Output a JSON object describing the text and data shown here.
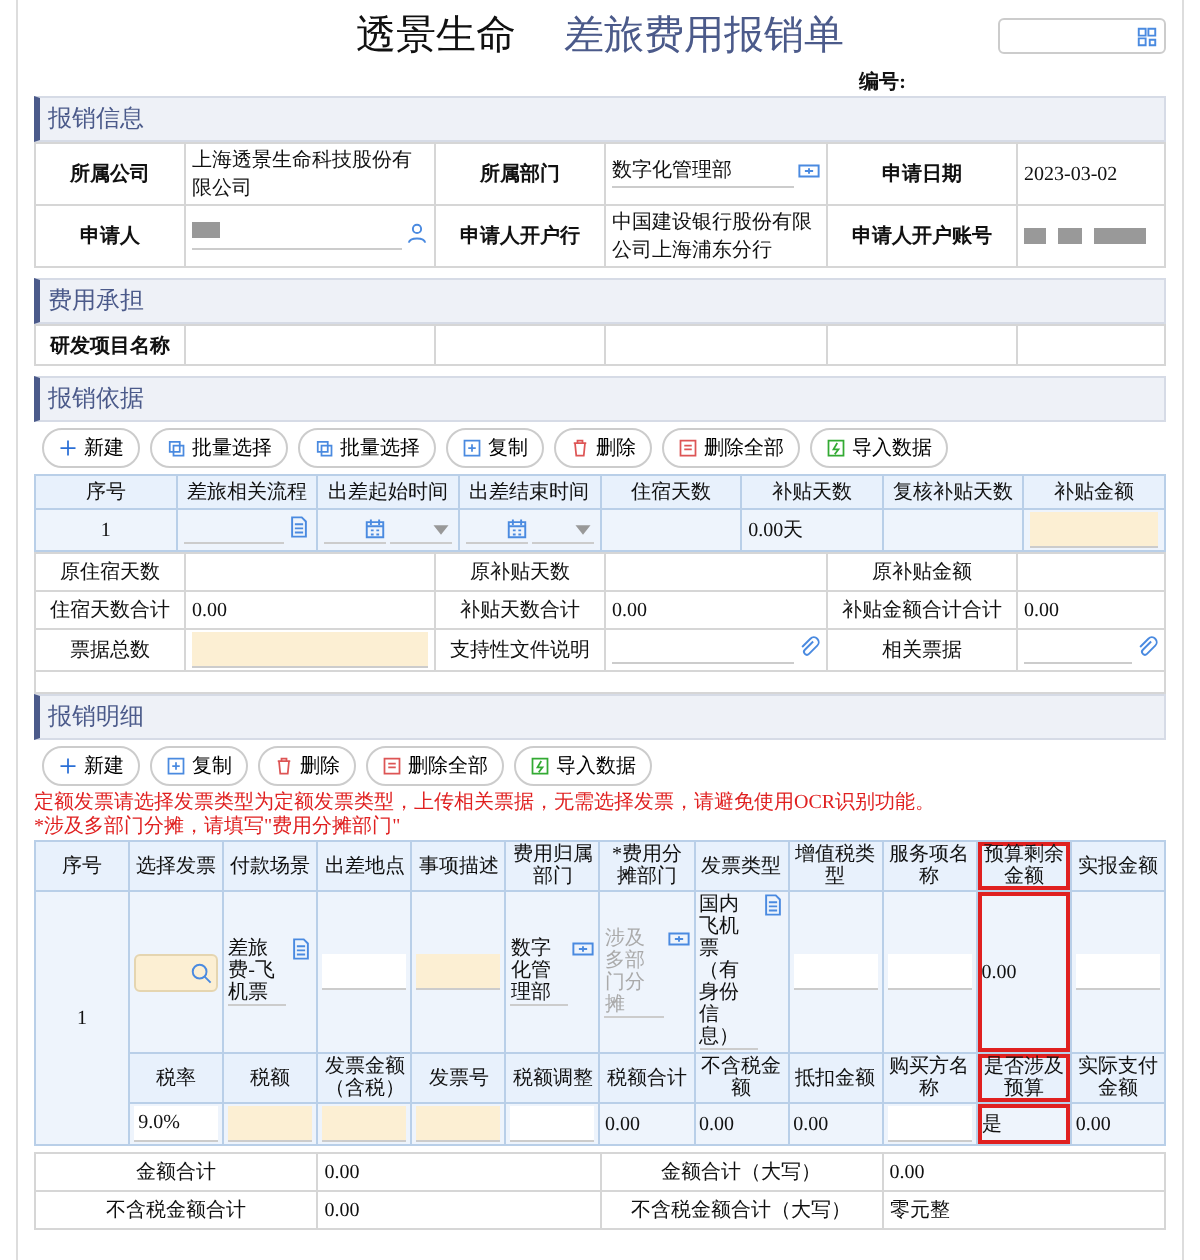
{
  "header": {
    "company": "透景生命",
    "title": "差旅费用报销单",
    "number_label": "编号:"
  },
  "info": {
    "title": "报销信息",
    "rows": [
      [
        {
          "label": "所属公司",
          "kind": "text",
          "value": "上海透景生命科技股份有限公司"
        },
        {
          "label": "所属部门",
          "kind": "picker",
          "value": "数字化管理部"
        },
        {
          "label": "申请日期",
          "kind": "text",
          "value": "2023-03-02"
        }
      ],
      [
        {
          "label": "申请人",
          "kind": "user"
        },
        {
          "label": "申请人开户行",
          "kind": "text",
          "value": "中国建设银行股份有限公司上海浦东分行"
        },
        {
          "label": "申请人开户账号",
          "kind": "redacted"
        }
      ]
    ]
  },
  "cost": {
    "title": "费用承担",
    "label": "研发项目名称"
  },
  "basis": {
    "title": "报销依据",
    "buttons": [
      {
        "label": "新建",
        "kind": "new"
      },
      {
        "label": "批量选择",
        "kind": "batch"
      },
      {
        "label": "批量选择",
        "kind": "batch"
      },
      {
        "label": "复制",
        "kind": "copy"
      },
      {
        "label": "删除",
        "kind": "delete"
      },
      {
        "label": "删除全部",
        "kind": "delete-all"
      },
      {
        "label": "导入数据",
        "kind": "import"
      }
    ],
    "columns": [
      "序号",
      "差旅相关流程",
      "出差起始时间",
      "出差结束时间",
      "住宿天数",
      "补贴天数",
      "复核补贴天数",
      "补贴金额"
    ],
    "row": [
      {
        "kind": "text",
        "text": "1"
      },
      {
        "kind": "lookup"
      },
      {
        "kind": "date"
      },
      {
        "kind": "date"
      },
      {
        "kind": "blank"
      },
      {
        "kind": "text",
        "text": "0.00天"
      },
      {
        "kind": "blank"
      },
      {
        "kind": "required"
      }
    ],
    "summary": [
      [
        {
          "label": "原住宿天数",
          "kind": "blank"
        },
        {
          "label": "原补贴天数",
          "kind": "blank"
        },
        {
          "label": "原补贴金额",
          "kind": "blank"
        }
      ],
      [
        {
          "label": "住宿天数合计",
          "kind": "text",
          "text": "0.00"
        },
        {
          "label": "补贴天数合计",
          "kind": "text",
          "text": "0.00"
        },
        {
          "label": "补贴金额合计合计",
          "kind": "text",
          "text": "0.00"
        }
      ],
      [
        {
          "label": "票据总数",
          "kind": "required"
        },
        {
          "label": "支持性文件说明",
          "kind": "attach"
        },
        {
          "label": "相关票据",
          "kind": "attach"
        }
      ]
    ]
  },
  "detail": {
    "title": "报销明细",
    "buttons": [
      {
        "label": "新建",
        "kind": "new"
      },
      {
        "label": "复制",
        "kind": "copy"
      },
      {
        "label": "删除",
        "kind": "delete"
      },
      {
        "label": "删除全部",
        "kind": "delete-all"
      },
      {
        "label": "导入数据",
        "kind": "import"
      }
    ],
    "notes": [
      "定额发票请选择发票类型为定额发票类型，上传相关票据，无需选择发票，请避免使用OCR识别功能。",
      "*涉及多部门分摊，请填写\"费用分摊部门\""
    ],
    "columns": [
      {
        "label": "序号",
        "highlighted": false
      },
      {
        "label": "选择发票",
        "highlighted": false
      },
      {
        "label": "付款场景",
        "highlighted": false
      },
      {
        "label": "出差地点",
        "highlighted": false
      },
      {
        "label": "事项描述",
        "highlighted": false
      },
      {
        "label": "费用归属部门",
        "highlighted": false
      },
      {
        "label": "*费用分摊部门",
        "highlighted": false
      },
      {
        "label": "发票类型",
        "highlighted": false
      },
      {
        "label": "增值税类型",
        "highlighted": false
      },
      {
        "label": "服务项名称",
        "highlighted": false
      },
      {
        "label": "预算剩余金额",
        "highlighted": true
      },
      {
        "label": "实报金额",
        "highlighted": false
      }
    ],
    "seq": "1",
    "row": [
      {
        "kind": "search"
      },
      {
        "kind": "lookup",
        "text": "差旅费-飞机票"
      },
      {
        "kind": "input"
      },
      {
        "kind": "required"
      },
      {
        "kind": "picker",
        "text": "数字化管理部"
      },
      {
        "kind": "picker",
        "placeholder": "涉及多部门分摊"
      },
      {
        "kind": "lookup",
        "text": "国内飞机票（有身份信息）"
      },
      {
        "kind": "input"
      },
      {
        "kind": "input"
      },
      {
        "kind": "text",
        "text": "0.00"
      },
      {
        "kind": "input"
      }
    ],
    "sub_columns": [
      {
        "label": "税率",
        "highlighted": false
      },
      {
        "label": "税额",
        "highlighted": false
      },
      {
        "label": "发票金额（含税）",
        "highlighted": false
      },
      {
        "label": "发票号",
        "highlighted": false
      },
      {
        "label": "税额调整",
        "highlighted": false
      },
      {
        "label": "税额合计",
        "highlighted": false
      },
      {
        "label": "不含税金额",
        "highlighted": false
      },
      {
        "label": "抵扣金额",
        "highlighted": false
      },
      {
        "label": "购买方名称",
        "highlighted": false
      },
      {
        "label": "是否涉及预算",
        "highlighted": true
      },
      {
        "label": "实际支付金额",
        "highlighted": false
      }
    ],
    "sub_row": [
      {
        "kind": "input",
        "text": "9.0%"
      },
      {
        "kind": "required"
      },
      {
        "kind": "required"
      },
      {
        "kind": "required"
      },
      {
        "kind": "input"
      },
      {
        "kind": "text",
        "text": "0.00"
      },
      {
        "kind": "text",
        "text": "0.00"
      },
      {
        "kind": "text",
        "text": "0.00"
      },
      {
        "kind": "input"
      },
      {
        "kind": "text",
        "text": "是"
      },
      {
        "kind": "text",
        "text": "0.00"
      }
    ],
    "totals": [
      [
        {
          "label": "金额合计",
          "value": "0.00"
        },
        {
          "label": "金额合计（大写）",
          "value": "0.00"
        }
      ],
      [
        {
          "label": "不含税金额合计",
          "value": "0.00"
        },
        {
          "label": "不含税金额合计（大写）",
          "value": "零元整"
        }
      ]
    ]
  }
}
